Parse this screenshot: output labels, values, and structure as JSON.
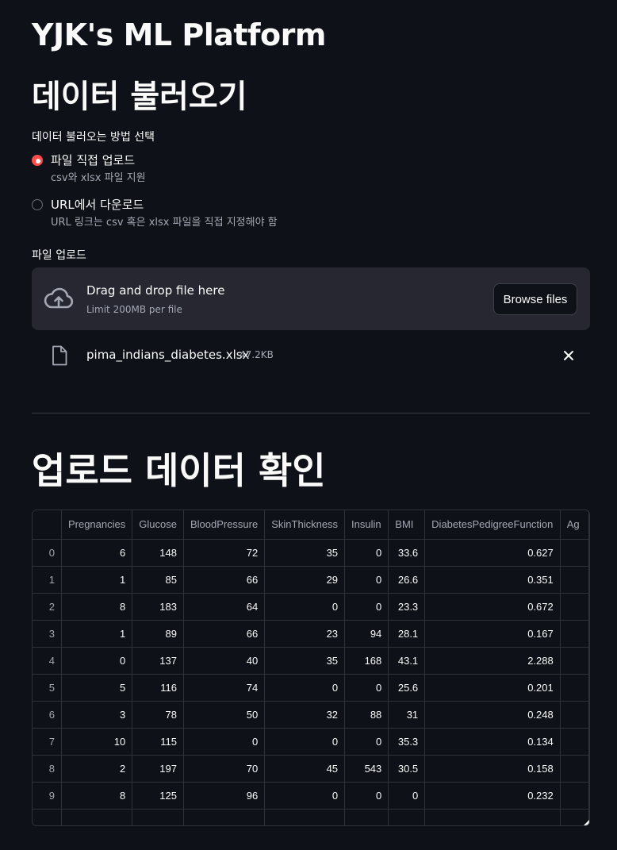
{
  "app_title": "YJK's ML Platform",
  "section_load": {
    "heading": "데이터 불러오기",
    "radio_label": "데이터 불러오는 방법 선택",
    "options": [
      {
        "label": "파일 직접 업로드",
        "help": "csv와 xlsx 파일 지원",
        "selected": true
      },
      {
        "label": "URL에서 다운로드",
        "help": "URL 링크는 csv 혹은 xlsx 파일을 직접 지정해야 함",
        "selected": false
      }
    ]
  },
  "uploader": {
    "label": "파일 업로드",
    "drag_text": "Drag and drop file here",
    "limit_text": "Limit 200MB per file",
    "browse_label": "Browse files",
    "file_name": "pima_indians_diabetes.xlsx",
    "file_size": "47.2KB"
  },
  "section_check": {
    "heading": "업로드 데이터 확인"
  },
  "dataframe": {
    "columns": [
      "Pregnancies",
      "Glucose",
      "BloodPressure",
      "SkinThickness",
      "Insulin",
      "BMI",
      "DiabetesPedigreeFunction",
      "Ag"
    ],
    "rows": [
      {
        "index": "0",
        "cells": [
          "6",
          "148",
          "72",
          "35",
          "0",
          "33.6",
          "0.627",
          ""
        ]
      },
      {
        "index": "1",
        "cells": [
          "1",
          "85",
          "66",
          "29",
          "0",
          "26.6",
          "0.351",
          ""
        ]
      },
      {
        "index": "2",
        "cells": [
          "8",
          "183",
          "64",
          "0",
          "0",
          "23.3",
          "0.672",
          ""
        ]
      },
      {
        "index": "3",
        "cells": [
          "1",
          "89",
          "66",
          "23",
          "94",
          "28.1",
          "0.167",
          ""
        ]
      },
      {
        "index": "4",
        "cells": [
          "0",
          "137",
          "40",
          "35",
          "168",
          "43.1",
          "2.288",
          ""
        ]
      },
      {
        "index": "5",
        "cells": [
          "5",
          "116",
          "74",
          "0",
          "0",
          "25.6",
          "0.201",
          ""
        ]
      },
      {
        "index": "6",
        "cells": [
          "3",
          "78",
          "50",
          "32",
          "88",
          "31",
          "0.248",
          ""
        ]
      },
      {
        "index": "7",
        "cells": [
          "10",
          "115",
          "0",
          "0",
          "0",
          "35.3",
          "0.134",
          ""
        ]
      },
      {
        "index": "8",
        "cells": [
          "2",
          "197",
          "70",
          "45",
          "543",
          "30.5",
          "0.158",
          ""
        ]
      },
      {
        "index": "9",
        "cells": [
          "8",
          "125",
          "96",
          "0",
          "0",
          "0",
          "0.232",
          ""
        ]
      },
      {
        "index": "",
        "cells": [
          "",
          "",
          "",
          "",
          "",
          "",
          "",
          ""
        ]
      }
    ]
  },
  "colors": {
    "accent": "#ff4b4b",
    "background": "#0e1117",
    "surface": "#262730"
  }
}
